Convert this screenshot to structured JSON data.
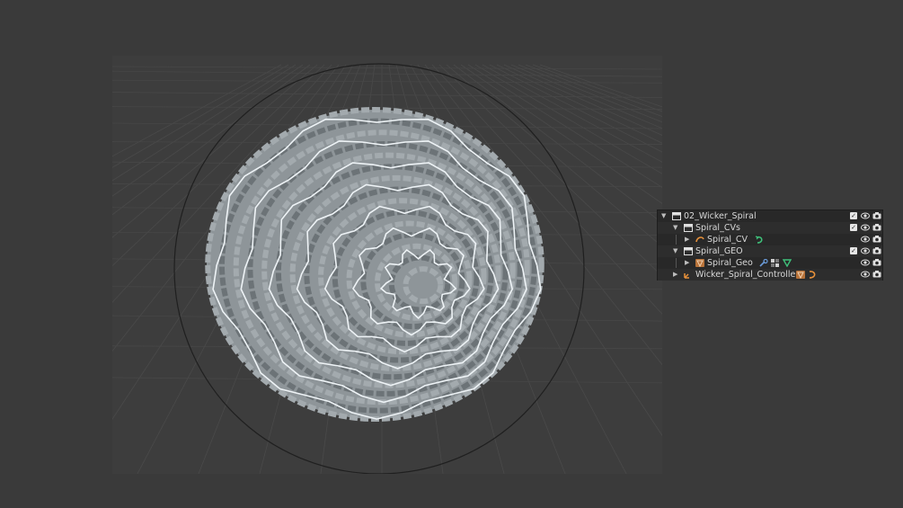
{
  "outliner": {
    "rows": [
      {
        "label": "02_Wicker_Spiral",
        "type": "collection",
        "expanded": true,
        "checked": true
      },
      {
        "label": "Spiral_CVs",
        "type": "collection",
        "expanded": true,
        "checked": true
      },
      {
        "label": "Spiral_CV",
        "type": "curve",
        "expanded": false,
        "modifiers": [
          "curve-data-icon"
        ]
      },
      {
        "label": "Spiral_GEO",
        "type": "collection",
        "expanded": true,
        "checked": true
      },
      {
        "label": "Spiral_Geo",
        "type": "mesh",
        "expanded": false,
        "modifiers": [
          "wrench-modifier-icon",
          "material-icon",
          "mesh-data-icon"
        ]
      },
      {
        "label": "Wicker_Spiral_Controller",
        "type": "empty",
        "expanded": false,
        "modifiers": [
          "mesh-object-icon",
          "curve-object-icon"
        ]
      }
    ]
  },
  "colors": {
    "background": "#3a3a3a",
    "viewport": "#3d3d3d",
    "outliner_bg": "#282828",
    "accent_orange": "#e8913a",
    "accent_green": "#3fc07a",
    "accent_blue": "#6a9bd8"
  }
}
